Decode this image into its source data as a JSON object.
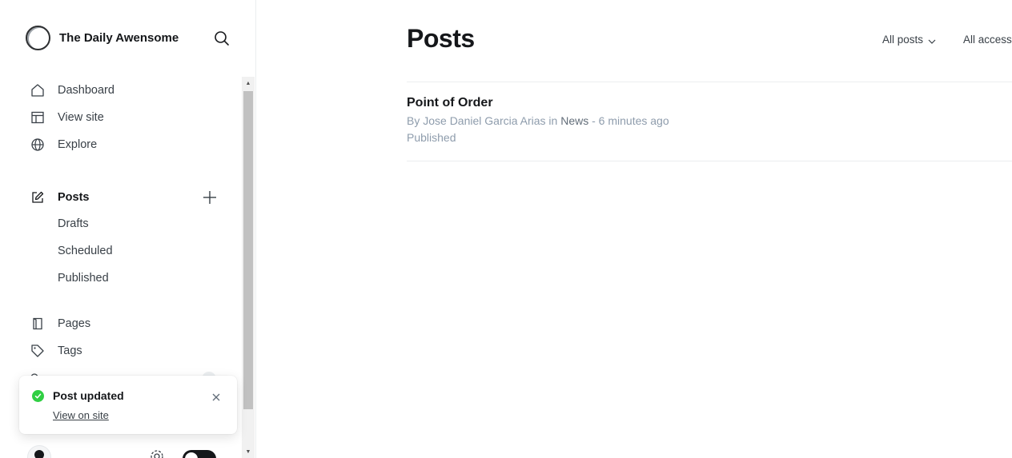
{
  "brand": {
    "name": "The Daily Awensome"
  },
  "nav": {
    "dashboard": "Dashboard",
    "view_site": "View site",
    "explore": "Explore",
    "posts": "Posts",
    "drafts": "Drafts",
    "scheduled": "Scheduled",
    "published": "Published",
    "pages": "Pages",
    "tags": "Tags"
  },
  "toast": {
    "title": "Post updated",
    "link": "View on site",
    "status_color": "#30cf43"
  },
  "main": {
    "title": "Posts",
    "filters": {
      "posts": "All posts",
      "access": "All access"
    },
    "posts": [
      {
        "title": "Point of Order",
        "by_prefix": "By ",
        "author": "Jose Daniel Garcia Arias",
        "in_word": " in ",
        "category": "News",
        "time": " - 6 minutes ago",
        "status": "Published"
      }
    ]
  }
}
